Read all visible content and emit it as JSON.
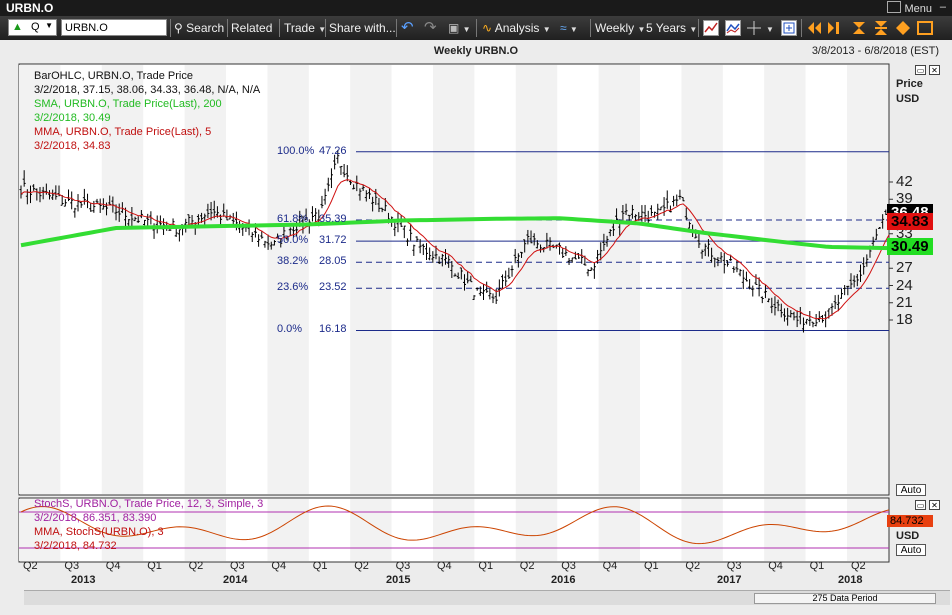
{
  "window": {
    "title": "URBN.O",
    "menu_label": "Menu"
  },
  "toolbar": {
    "security_type": "Q",
    "symbol": "URBN.O",
    "search": "Search",
    "related": "Related",
    "trade": "Trade",
    "share": "Share with...",
    "analysis": "Analysis",
    "periodicity": "Weekly",
    "range": "5 Years"
  },
  "chart": {
    "title": "Weekly URBN.O",
    "date_range": "3/8/2013 - 6/8/2018 (EST)",
    "price_axis_title": "Price",
    "price_axis_unit": "USD",
    "price_ticks": [
      "42",
      "39",
      "36",
      "33",
      "30",
      "27",
      "24",
      "21",
      "18"
    ],
    "last_price": "36.48",
    "mma_badge": "34.83",
    "sma_badge": "30.49",
    "stoch_badge": "84.732",
    "stoch_axis_unit": "USD",
    "auto_label": "Auto",
    "scroll_label": "275 Data Period",
    "legend": {
      "ohlc_title": "BarOHLC, URBN.O, Trade Price",
      "ohlc_values": "3/2/2018, 37.15, 38.06, 34.33, 36.48, N/A, N/A",
      "sma_title": "SMA, URBN.O, Trade Price(Last),  200",
      "sma_values": "3/2/2018, 30.49",
      "mma_title": "MMA, URBN.O, Trade Price(Last),  5",
      "mma_values": "3/2/2018, 34.83"
    },
    "stoch_legend": {
      "line1": "StochS, URBN.O, Trade Price,  12, 3, Simple, 3",
      "line2": "3/2/2018, 86.351, 83.390",
      "line3": "MMA, StochS(URBN.O),  3",
      "line4": "3/2/2018, 84.732"
    },
    "fib_levels": [
      {
        "pct": "100.0%",
        "val": "47.26"
      },
      {
        "pct": "61.8%",
        "val": "35.39"
      },
      {
        "pct": "50.0%",
        "val": "31.72"
      },
      {
        "pct": "38.2%",
        "val": "28.05"
      },
      {
        "pct": "23.6%",
        "val": "23.52"
      },
      {
        "pct": "0.0%",
        "val": "16.18"
      }
    ],
    "quarters": [
      "Q2",
      "Q3",
      "Q4",
      "Q1",
      "Q2",
      "Q3",
      "Q4",
      "Q1",
      "Q2",
      "Q3",
      "Q4",
      "Q1",
      "Q2",
      "Q3",
      "Q4",
      "Q1",
      "Q2",
      "Q3",
      "Q4",
      "Q1",
      "Q2"
    ],
    "years": [
      "2013",
      "2014",
      "2015",
      "2016",
      "2017",
      "2018"
    ],
    "colors": {
      "bars": "#000000",
      "sma": "#33dd33",
      "mma": "#d01010",
      "fib": "#1c2b8a",
      "stoch": "#cc4400",
      "stoch_band": "#b030b0",
      "last_badge_bg": "#000000",
      "mma_badge_bg": "#e01010",
      "sma_badge_bg": "#22dd22"
    }
  }
}
